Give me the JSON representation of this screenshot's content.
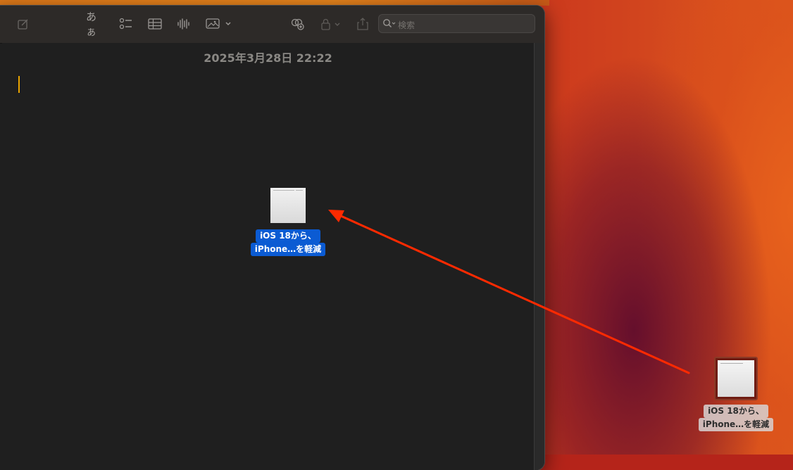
{
  "toolbar": {
    "format_label": "あぁ",
    "search_placeholder": "検索"
  },
  "note": {
    "date": "2025年3月28日 22:22"
  },
  "dragged_file": {
    "line1": "iOS 18から、",
    "line2": "iPhone…を軽減"
  },
  "desktop_file": {
    "line1": "iOS 18から、",
    "line2": "iPhone…を軽減"
  },
  "annotation": {
    "arrow_color": "#ff2a00"
  },
  "colors": {
    "selection": "#0b5bd3",
    "caret": "#e9a400"
  }
}
